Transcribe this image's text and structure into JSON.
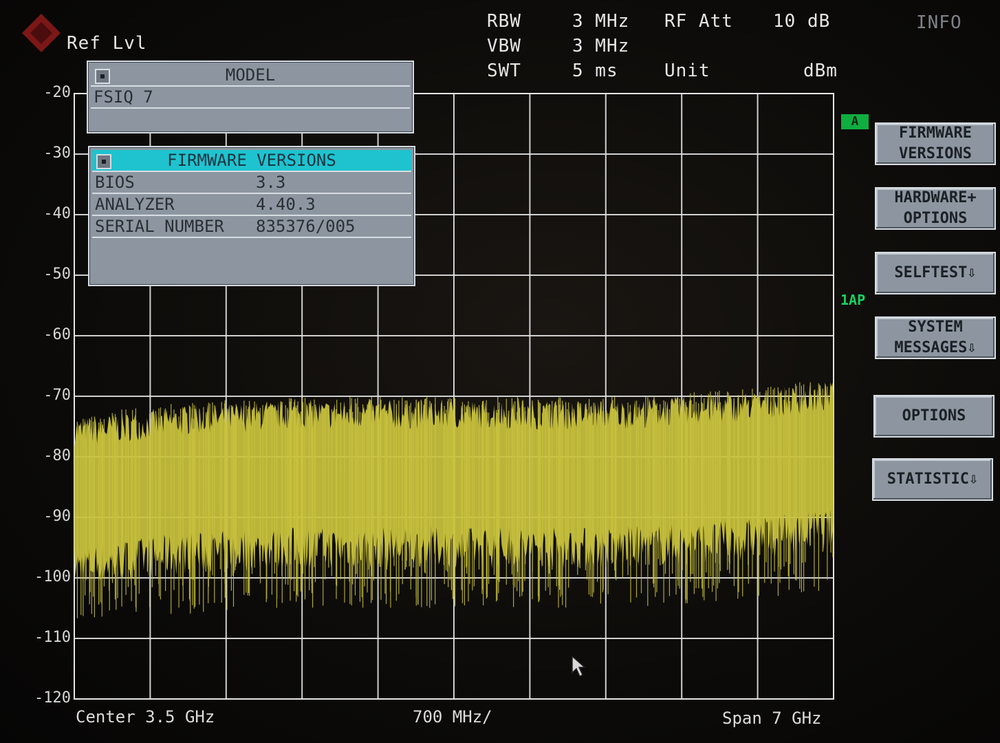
{
  "header": {
    "ref_lvl_label": "Ref Lvl",
    "rbw_label": "RBW",
    "rbw_value": "3 MHz",
    "vbw_label": "VBW",
    "vbw_value": "3 MHz",
    "swt_label": "SWT",
    "swt_value": "5 ms",
    "rf_att_label": "RF Att",
    "rf_att_value": "10 dB",
    "unit_label": "Unit",
    "unit_value": "dBm",
    "info_label": "INFO"
  },
  "trace": {
    "a_badge": "A",
    "iap_label": "1AP"
  },
  "model_dialog": {
    "title": "MODEL",
    "value": "FSIQ 7"
  },
  "firmware_dialog": {
    "title": "FIRMWARE VERSIONS",
    "rows": [
      {
        "key": "BIOS",
        "value": "3.3"
      },
      {
        "key": "ANALYZER",
        "value": "4.40.3"
      },
      {
        "key": "SERIAL NUMBER",
        "value": "835376/005"
      }
    ]
  },
  "softkeys": [
    "FIRMWARE\nVERSIONS",
    "HARDWARE+\nOPTIONS",
    "SELFTEST⇩",
    "SYSTEM\nMESSAGES⇩",
    "OPTIONS",
    "STATISTIC⇩"
  ],
  "footer": {
    "center": "Center 3.5 GHz",
    "div": "700 MHz/",
    "span": "Span 7 GHz"
  },
  "colors": {
    "trace": "#c9c23e",
    "grid": "#e6e6e6",
    "dialog": "#8d96a0",
    "active_title": "#1ec3cf"
  },
  "chart_data": {
    "type": "line",
    "y_unit": "dBm",
    "yticks": [
      -20,
      -30,
      -40,
      -50,
      -60,
      -70,
      -80,
      -90,
      -100,
      -110,
      -120
    ],
    "ylim": [
      -120,
      -20
    ],
    "xlim_ghz": [
      0,
      7
    ],
    "x_divisions": 10,
    "series": [
      {
        "x_ghz": [
          0,
          1,
          2,
          3,
          4,
          5,
          6,
          7
        ],
        "peak_dbm": [
          -76,
          -74,
          -73,
          -73,
          -73,
          -73,
          -72,
          -70
        ],
        "floor_dbm": [
          -98,
          -96,
          -95,
          -95,
          -95,
          -95,
          -94,
          -92
        ]
      }
    ]
  }
}
